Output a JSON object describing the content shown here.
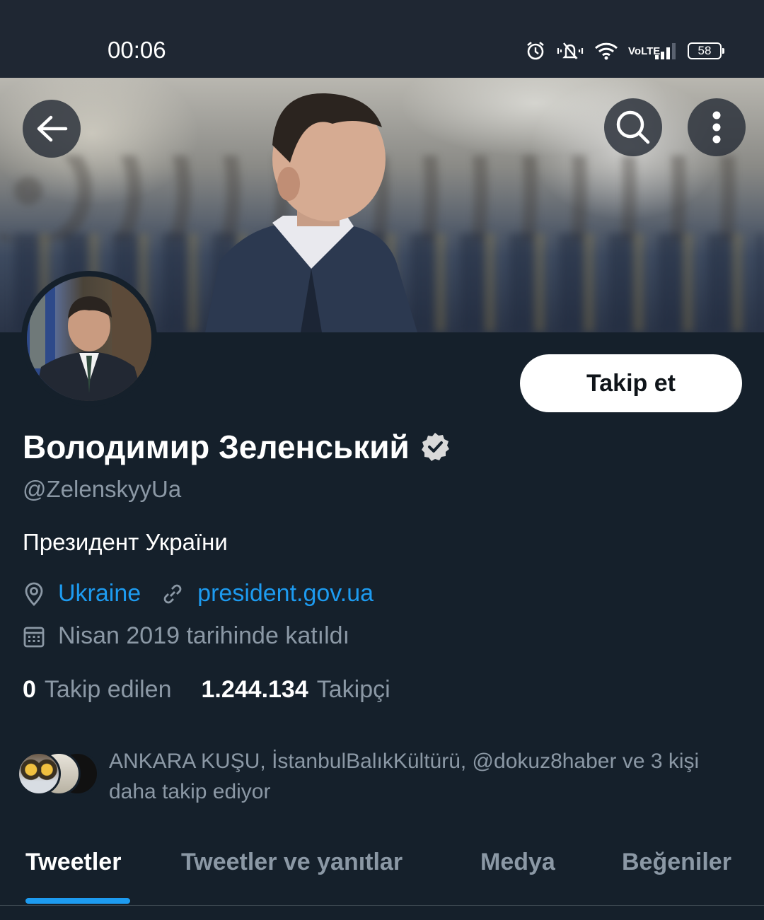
{
  "status_bar": {
    "time": "00:06",
    "icons": [
      "alarm-icon",
      "silent-icon",
      "wifi-icon",
      "volte-icon",
      "signal-icon"
    ],
    "volte_top": "Vo",
    "volte_bottom": "LTE",
    "battery": "58"
  },
  "banner": {
    "back_icon": "back-arrow-icon",
    "search_icon": "search-icon",
    "more_icon": "more-vertical-icon"
  },
  "profile": {
    "follow_label": "Takip et",
    "display_name": "Володимир Зеленський",
    "verified": true,
    "handle": "@ZelenskyyUa",
    "bio": "Президент України",
    "location": "Ukraine",
    "website": "president.gov.ua",
    "joined": "Nisan 2019 tarihinde katıldı",
    "following_count": "0",
    "following_label": "Takip edilen",
    "followers_count": "1.244.134",
    "followers_label": "Takipçi"
  },
  "followers_you_know": {
    "text": "ANKARA KUŞU, İstanbulBalıkKültürü, @dokuz8haber ve 3 kişi daha takip ediyor"
  },
  "tabs": [
    {
      "label": "Tweetler",
      "active": true
    },
    {
      "label": "Tweetler ve yanıtlar",
      "active": false
    },
    {
      "label": "Medya",
      "active": false
    },
    {
      "label": "Beğeniler",
      "active": false
    }
  ],
  "colors": {
    "background": "#15202b",
    "accent": "#1d9bf0",
    "muted": "#8b98a5"
  }
}
